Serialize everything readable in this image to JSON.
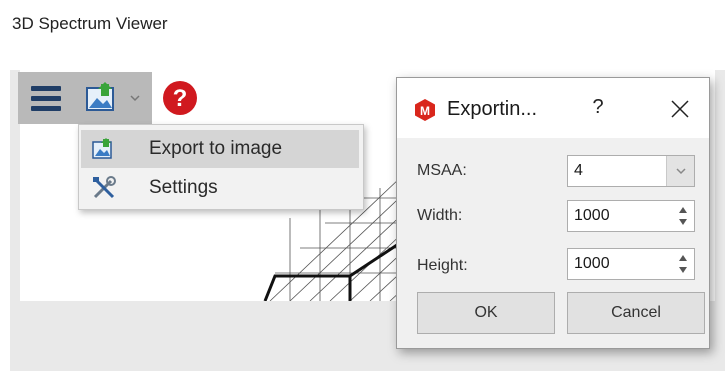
{
  "app": {
    "title": "3D Spectrum Viewer"
  },
  "toolbar": {
    "menu_icon": "hamburger-menu-icon",
    "export_icon": "export-image-icon",
    "dropdown_arrow_icon": "chevron-down-icon",
    "help_icon": "help-icon",
    "help_color": "#d0191f"
  },
  "menu": {
    "items": [
      {
        "label": "Export to image",
        "icon": "export-image-icon"
      },
      {
        "label": "Settings",
        "icon": "settings-tools-icon"
      }
    ]
  },
  "dialog": {
    "title": "Exportin...",
    "help_label": "?",
    "app_icon_color": "#d9261c",
    "msaa": {
      "label": "MSAA:",
      "value": "4"
    },
    "width": {
      "label": "Width:",
      "value": "1000"
    },
    "height": {
      "label": "Height:",
      "value": "1000"
    },
    "ok_label": "OK",
    "cancel_label": "Cancel"
  }
}
